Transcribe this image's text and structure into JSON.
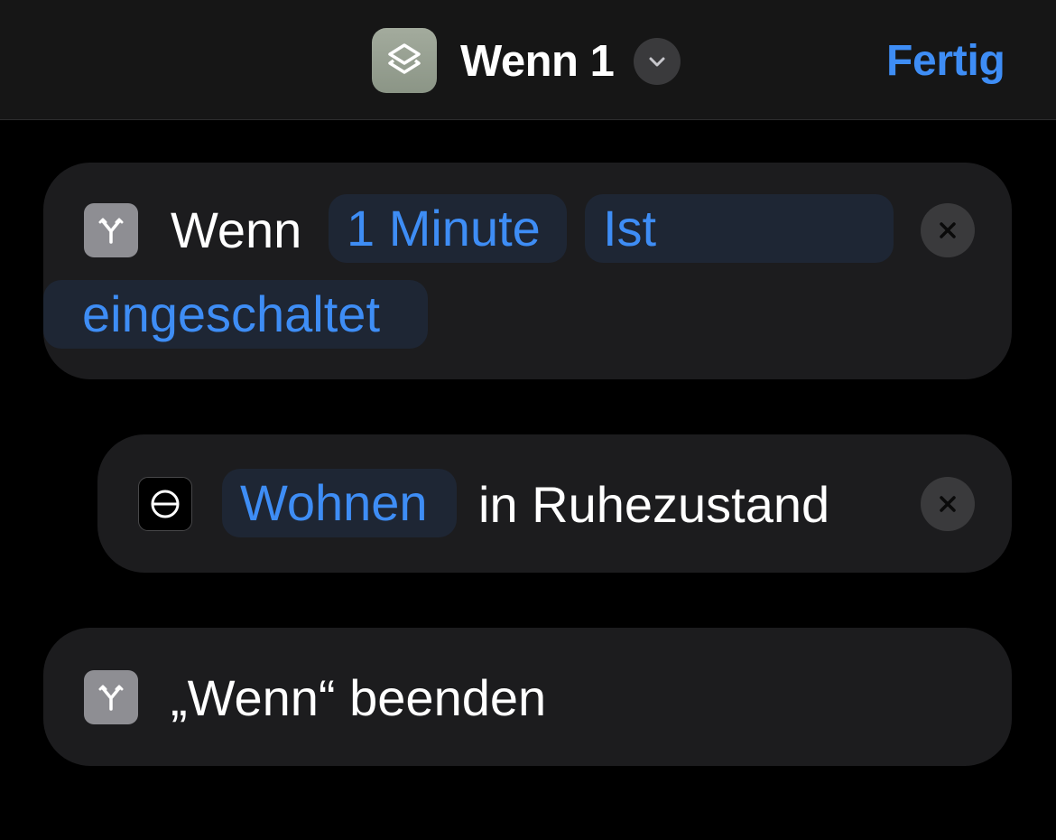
{
  "header": {
    "app_icon": "shortcuts-icon",
    "title": "Wenn 1",
    "menu_icon": "chevron-down-icon",
    "done_label": "Fertig"
  },
  "actions": [
    {
      "icon": "branch-icon",
      "label": "Wenn",
      "tokens": [
        "1 Minute",
        "Ist",
        "eingeschaltet"
      ],
      "remove_icon": "close-icon"
    },
    {
      "icon": "scene-icon",
      "token": "Wohnen",
      "label": "in Ruhezustand",
      "remove_icon": "close-icon"
    },
    {
      "icon": "branch-icon",
      "label": "„Wenn“ beenden"
    }
  ],
  "colors": {
    "accent": "#3e8df5",
    "background": "#000000",
    "card": "#1c1c1e",
    "token_bg": "#1e2634"
  }
}
